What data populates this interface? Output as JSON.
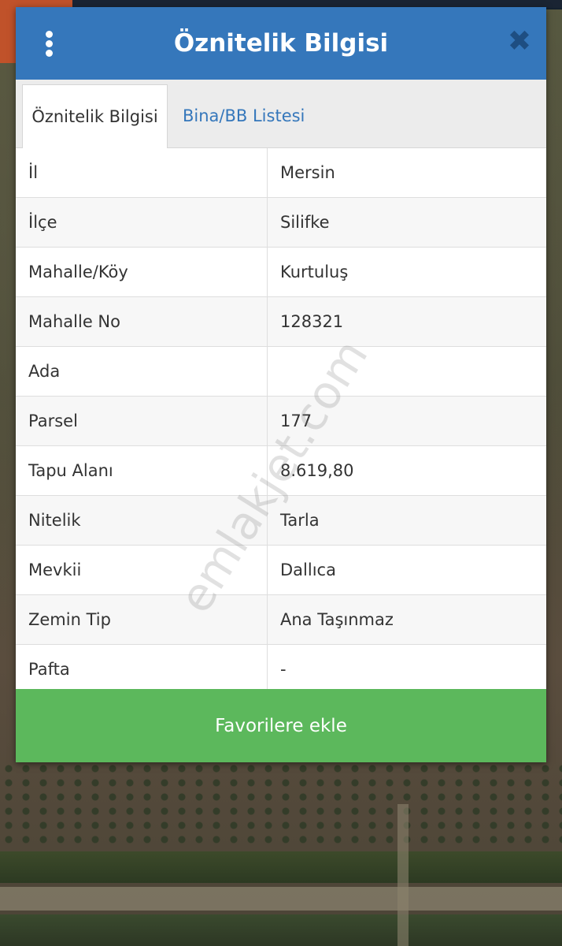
{
  "dialog": {
    "title": "Öznitelik Bilgisi",
    "menu_icon": "more-vertical-icon",
    "close_icon": "close-icon",
    "close_glyph": "✖"
  },
  "tabs": [
    {
      "label": "Öznitelik Bilgisi",
      "active": true
    },
    {
      "label": "Bina/BB Listesi",
      "active": false
    }
  ],
  "attributes": [
    {
      "label": "İl",
      "value": "Mersin"
    },
    {
      "label": "İlçe",
      "value": "Silifke"
    },
    {
      "label": "Mahalle/Köy",
      "value": "Kurtuluş"
    },
    {
      "label": "Mahalle No",
      "value": "128321"
    },
    {
      "label": "Ada",
      "value": ""
    },
    {
      "label": "Parsel",
      "value": "177"
    },
    {
      "label": "Tapu Alanı",
      "value": "8.619,80"
    },
    {
      "label": "Nitelik",
      "value": "Tarla"
    },
    {
      "label": "Mevkii",
      "value": "Dallıca"
    },
    {
      "label": "Zemin Tip",
      "value": "Ana Taşınmaz"
    },
    {
      "label": "Pafta",
      "value": "-"
    }
  ],
  "actions": {
    "favorite_label": "Favorilere ekle"
  },
  "watermark": "emlakjet.com",
  "colors": {
    "header": "#3577bb",
    "button": "#5cb85c",
    "tab_link": "#3577bb"
  }
}
